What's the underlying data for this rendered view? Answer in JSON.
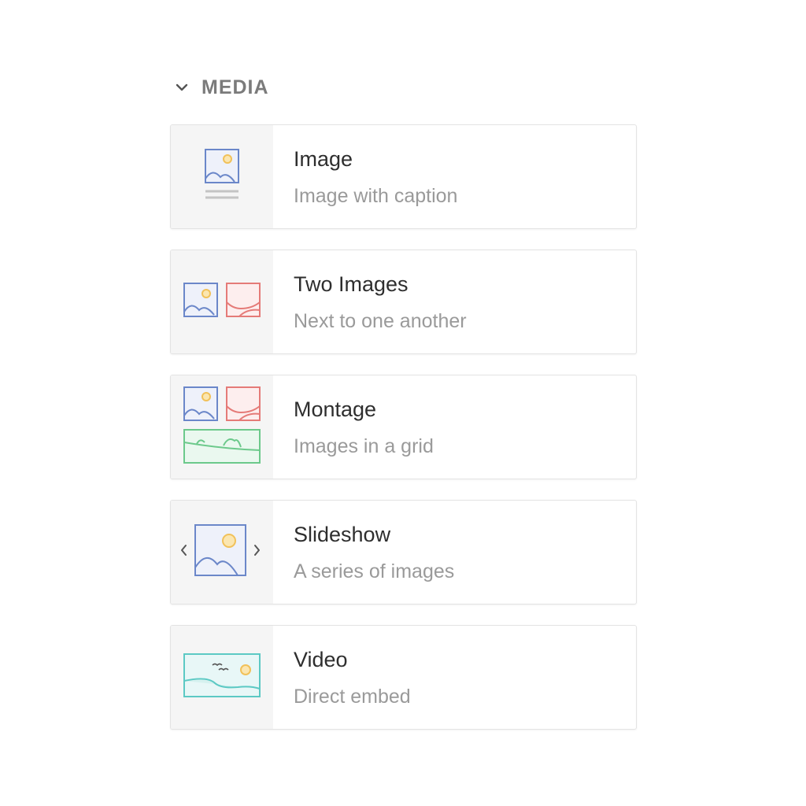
{
  "section": {
    "title": "MEDIA",
    "icon": "chevron-down-icon"
  },
  "colors": {
    "blue": "#6b87c9",
    "red": "#e57b78",
    "green": "#6cc98b",
    "teal": "#5cc9c4",
    "sun": "#f1c15a",
    "muted_text": "#9a9a9a",
    "title_text": "#2e2e2e",
    "thumb_bg": "#f5f5f5"
  },
  "items": [
    {
      "id": "image",
      "title": "Image",
      "subtitle": "Image with caption",
      "icon": "image-caption-icon"
    },
    {
      "id": "two-images",
      "title": "Two Images",
      "subtitle": "Next to one another",
      "icon": "two-images-icon"
    },
    {
      "id": "montage",
      "title": "Montage",
      "subtitle": "Images in a grid",
      "icon": "montage-icon"
    },
    {
      "id": "slideshow",
      "title": "Slideshow",
      "subtitle": "A series of images",
      "icon": "slideshow-icon"
    },
    {
      "id": "video",
      "title": "Video",
      "subtitle": "Direct embed",
      "icon": "video-icon"
    }
  ]
}
